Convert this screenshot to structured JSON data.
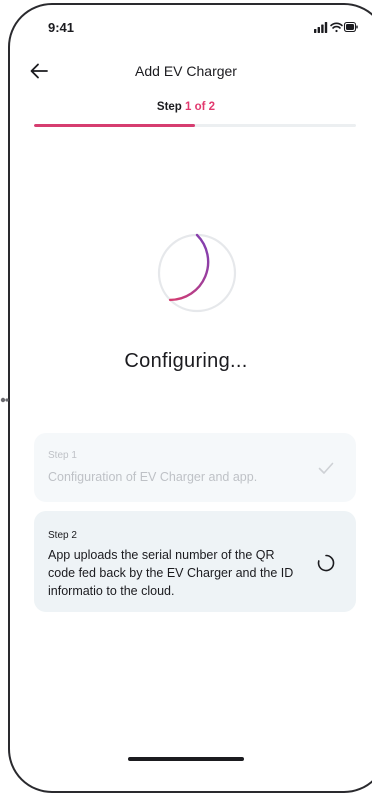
{
  "status_bar": {
    "time": "9:41",
    "icons": [
      "signal-icon",
      "wifi-icon",
      "battery-icon"
    ]
  },
  "header": {
    "back_icon": "arrow-left-icon",
    "title": "Add EV Charger"
  },
  "stepper": {
    "prefix": "Step",
    "current_text": "1 of 2",
    "progress": 0.5,
    "accent_color": "#e23a6f"
  },
  "loading": {
    "status_text": "Configuring...",
    "spinner_colors": [
      "#d63d70",
      "#7b3fb5"
    ]
  },
  "steps": [
    {
      "label": "Step 1",
      "description": "Configuration of EV Charger and app.",
      "state": "done",
      "icon": "check-icon"
    },
    {
      "label": "Step 2",
      "description": "App uploads the serial number of the QR code fed back by the EV Charger and the ID informatio to the cloud.",
      "state": "in-progress",
      "icon": "loading-spinner-icon"
    }
  ]
}
